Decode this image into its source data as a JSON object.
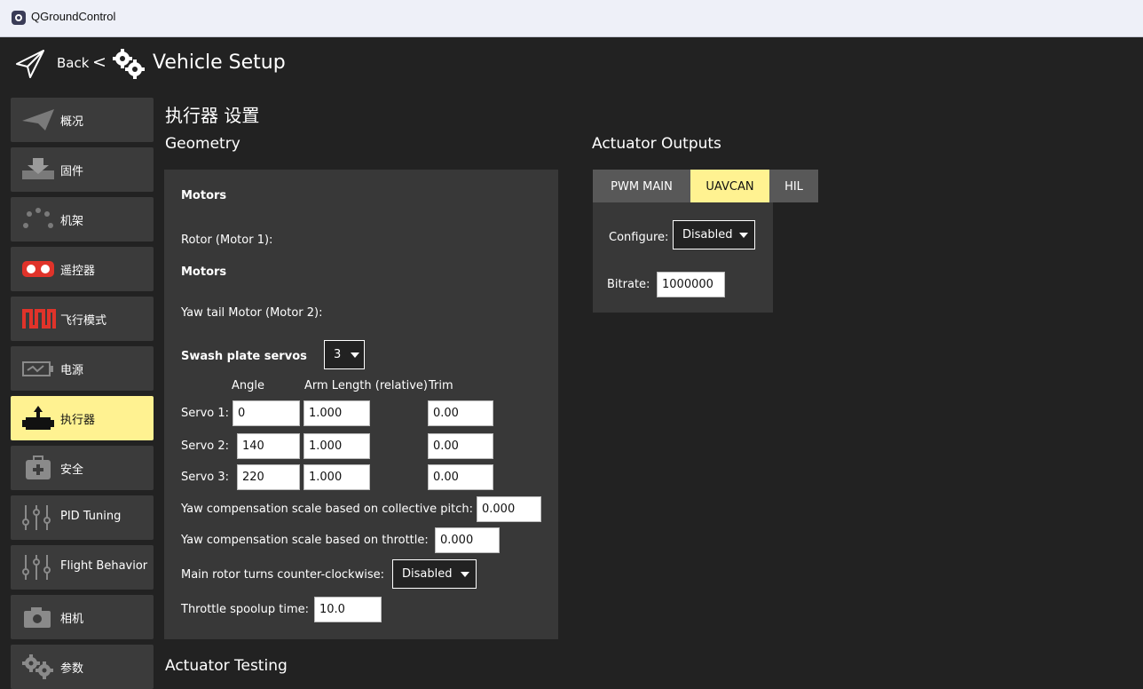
{
  "app": {
    "window_title": "QGroundControl"
  },
  "toolbar": {
    "back_label": "Back",
    "separator": "<",
    "page_title": "Vehicle Setup"
  },
  "sidebar": {
    "items": [
      {
        "label": "概况",
        "icon": "plane-icon"
      },
      {
        "label": "固件",
        "icon": "download-icon"
      },
      {
        "label": "机架",
        "icon": "frame-icon"
      },
      {
        "label": "遥控器",
        "icon": "remote-control-icon"
      },
      {
        "label": "飞行模式",
        "icon": "flight-modes-icon"
      },
      {
        "label": "电源",
        "icon": "battery-icon"
      },
      {
        "label": "执行器",
        "icon": "actuator-icon",
        "active": true
      },
      {
        "label": "安全",
        "icon": "safety-icon"
      },
      {
        "label": "PID Tuning",
        "icon": "sliders-icon"
      },
      {
        "label": "Flight Behavior",
        "icon": "sliders-icon"
      },
      {
        "label": "相机",
        "icon": "camera-icon"
      },
      {
        "label": "参数",
        "icon": "gears-icon"
      }
    ]
  },
  "page": {
    "heading": "执行器 设置",
    "geometry_title": "Geometry",
    "outputs_title": "Actuator Outputs",
    "testing_title": "Actuator Testing"
  },
  "geometry": {
    "motors_label_1": "Motors",
    "rotor_label": "Rotor (Motor 1):",
    "motors_label_2": "Motors",
    "yaw_tail_label": "Yaw tail Motor (Motor 2):",
    "swash_label": "Swash plate servos",
    "swash_value": "3",
    "columns": {
      "angle": "Angle",
      "arm_length": "Arm Length (relative)",
      "trim": "Trim"
    },
    "servos": [
      {
        "label": "Servo 1:",
        "angle": "0",
        "arm_length": "1.000",
        "trim": "0.00"
      },
      {
        "label": "Servo 2:",
        "angle": "140",
        "arm_length": "1.000",
        "trim": "0.00"
      },
      {
        "label": "Servo 3:",
        "angle": "220",
        "arm_length": "1.000",
        "trim": "0.00"
      }
    ],
    "yaw_collective_label": "Yaw compensation scale based on collective pitch:",
    "yaw_collective_value": "0.000",
    "yaw_throttle_label": "Yaw compensation scale based on throttle:",
    "yaw_throttle_value": "0.000",
    "ccw_label": "Main rotor turns counter-clockwise:",
    "ccw_value": "Disabled",
    "spoolup_label": "Throttle spoolup time:",
    "spoolup_value": "10.0"
  },
  "outputs": {
    "tabs": [
      {
        "label": "PWM MAIN",
        "active": false
      },
      {
        "label": "UAVCAN",
        "active": true
      },
      {
        "label": "HIL",
        "active": false
      }
    ],
    "configure_label": "Configure:",
    "configure_value": "Disabled",
    "bitrate_label": "Bitrate:",
    "bitrate_value": "1000000"
  },
  "colors": {
    "background": "#222222",
    "panel": "#383838",
    "button": "#3b3b3b",
    "accent": "#fff291",
    "tab": "#585858"
  }
}
